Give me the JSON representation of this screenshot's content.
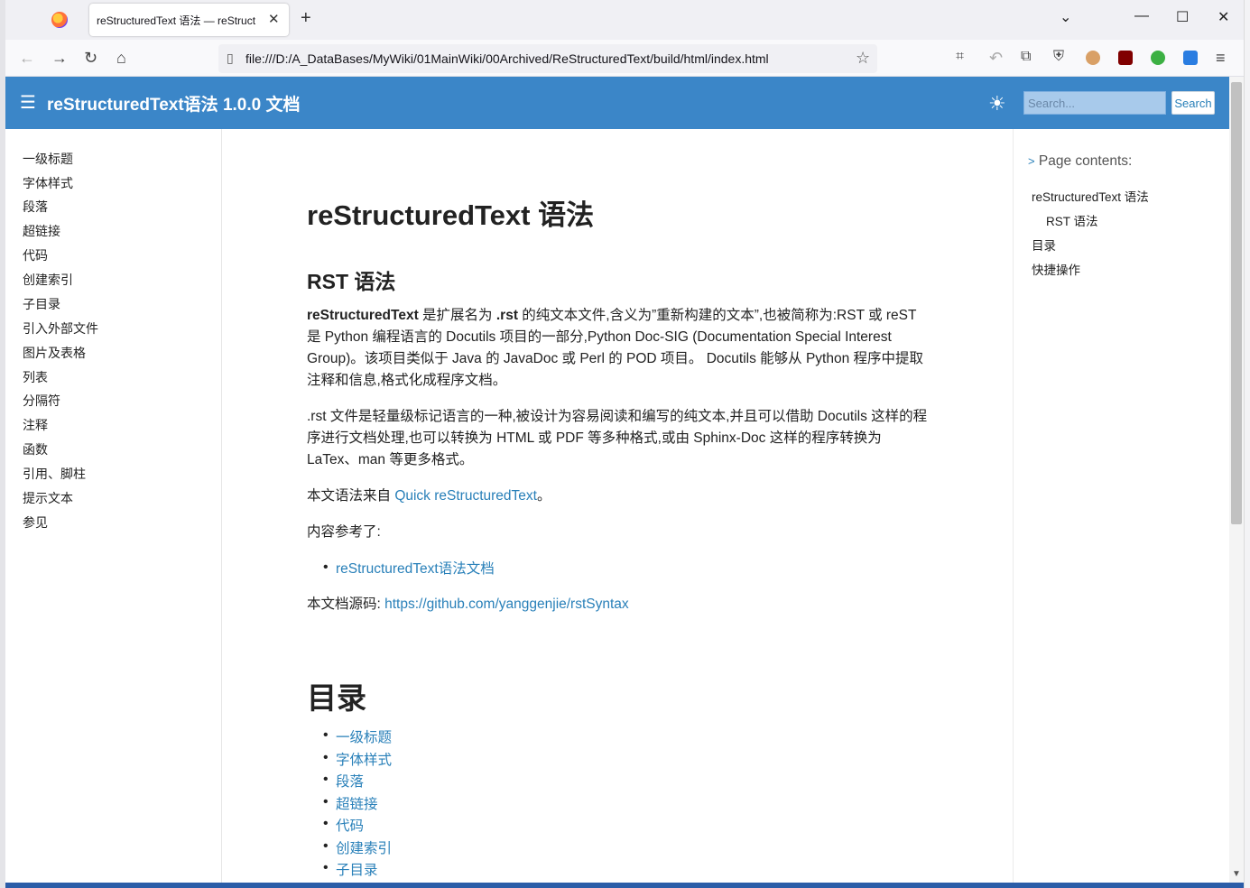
{
  "browser": {
    "tab_title": "reStructuredText 语法 — reStruct",
    "url": "file:///D:/A_DataBases/MyWiki/01MainWiki/00Archived/ReStructuredText/build/html/index.html"
  },
  "header": {
    "title": "reStructuredText语法 1.0.0 文档",
    "search_placeholder": "Search...",
    "search_button": "Search"
  },
  "sidebar": {
    "items": [
      "一级标题",
      "字体样式",
      "段落",
      "超链接",
      "代码",
      "创建索引",
      "子目录",
      "引入外部文件",
      "图片及表格",
      "列表",
      "分隔符",
      "注释",
      "函数",
      "引用、脚柱",
      "提示文本",
      "参见"
    ]
  },
  "main": {
    "h1": "reStructuredText 语法",
    "h2": "RST 语法",
    "p1_bold": "reStructuredText",
    "p1_a": " 是扩展名为 ",
    "p1_ext": ".rst",
    "p1_b": " 的纯文本文件,含义为”重新构建的文本”,也被简称为:RST 或 reST 是 Python 编程语言的 Docutils 项目的一部分,Python Doc-SIG (Documentation Special Interest Group)。该项目类似于 Java 的 JavaDoc 或 Perl 的 POD 项目。 Docutils 能够从 Python 程序中提取注释和信息,格式化成程序文档。",
    "p2": ".rst 文件是轻量级标记语言的一种,被设计为容易阅读和编写的纯文本,并且可以借助 Docutils 这样的程序进行文档处理,也可以转换为 HTML 或 PDF 等多种格式,或由 Sphinx-Doc 这样的程序转换为 LaTex、man 等更多格式。",
    "p3_text": "本文语法来自 ",
    "p3_link": "Quick reStructuredText",
    "p3_end": "。",
    "p4": "内容参考了:",
    "ref_link": "reStructuredText语法文档",
    "p5_text": "本文档源码: ",
    "p5_link": "https://github.com/yanggenjie/rstSyntax",
    "toc_heading": "目录",
    "toc_items": [
      "一级标题",
      "字体样式",
      "段落",
      "超链接",
      "代码",
      "创建索引",
      "子目录"
    ]
  },
  "page_contents": {
    "title": "Page contents:",
    "arrow": ">",
    "items": [
      "reStructuredText 语法",
      "RST 语法",
      "目录",
      "快捷操作"
    ]
  }
}
